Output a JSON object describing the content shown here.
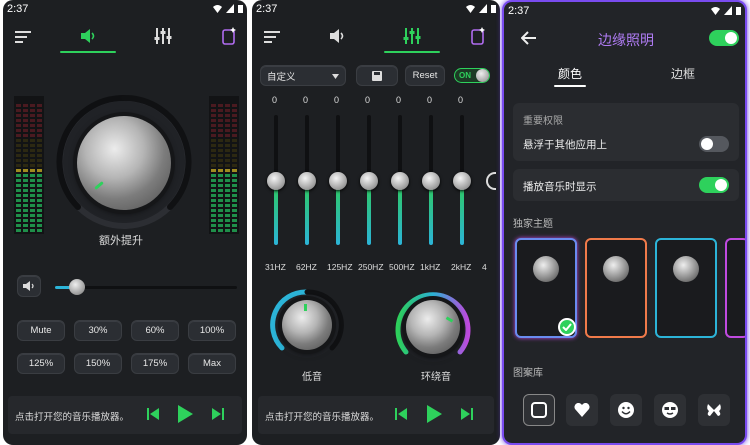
{
  "status_time": "2:37",
  "screen1": {
    "boost_label": "额外提升",
    "presets_row1": [
      "Mute",
      "30%",
      "60%",
      "100%"
    ],
    "presets_row2": [
      "125%",
      "150%",
      "175%",
      "Max"
    ],
    "volume_level": 0.12,
    "player_text": "点击打开您的音乐播放器。"
  },
  "screen2": {
    "preset_select": "自定义",
    "reset_label": "Reset",
    "on_label": "ON",
    "band_values": [
      "0",
      "0",
      "0",
      "0",
      "0",
      "0",
      "0"
    ],
    "band_labels": [
      "31HZ",
      "62HZ",
      "125HZ",
      "250HZ",
      "500HZ",
      "1kHZ",
      "2kHZ",
      "4"
    ],
    "bass_label": "低音",
    "surround_label": "环绕音",
    "player_text": "点击打开您的音乐播放器。"
  },
  "screen3": {
    "title": "边缘照明",
    "tab_color": "颜色",
    "tab_border": "边框",
    "permission_section": "重要权限",
    "overlay_label": "悬浮于其他应用上",
    "overlay_on": false,
    "show_playing_label": "播放音乐时显示",
    "show_playing_on": true,
    "exclusive_theme": "独家主题",
    "pattern_library": "图案库"
  },
  "colors": {
    "accent_green": "#2ed15c",
    "accent_purple": "#b06cf0",
    "title_purple": "#b07cf4"
  }
}
